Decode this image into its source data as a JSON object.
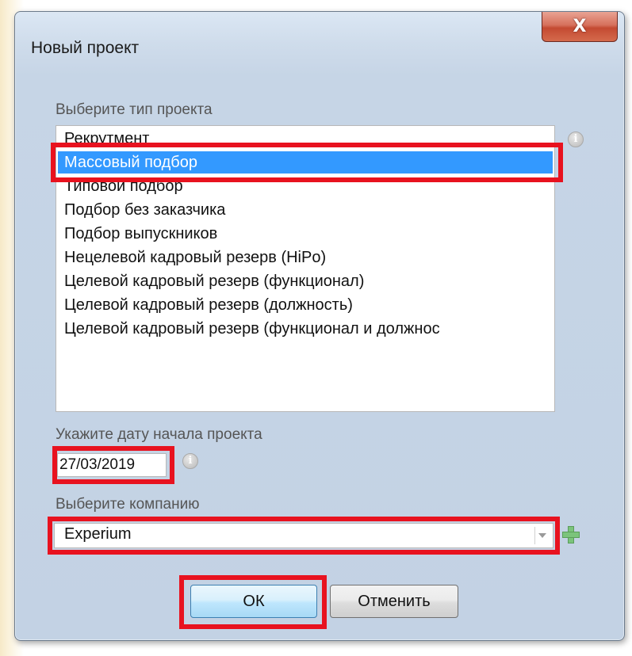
{
  "window": {
    "title": "Новый проект",
    "close_glyph": "X"
  },
  "project_type": {
    "label": "Выберите тип проекта",
    "items": [
      "Рекрутмент",
      "Массовый подбор",
      "Типовой подбор",
      "Подбор без заказчика",
      "Подбор выпускников",
      "Нецелевой кадровый резерв (HiPo)",
      "Целевой кадровый резерв (функционал)",
      "Целевой кадровый резерв (должность)",
      "Целевой кадровый резерв (функционал и должнос"
    ],
    "selected_index": 1,
    "info_icon": "info-icon"
  },
  "start_date": {
    "label": "Укажите дату начала проекта",
    "value": "27/03/2019",
    "info_icon": "info-icon"
  },
  "company": {
    "label": "Выберите компанию",
    "value": "Experium",
    "add_icon": "plus-icon"
  },
  "buttons": {
    "ok": "ОК",
    "cancel": "Отменить"
  },
  "colors": {
    "selection": "#3399ff",
    "highlight": "#e8121f",
    "add_icon": "#7bc47b"
  }
}
